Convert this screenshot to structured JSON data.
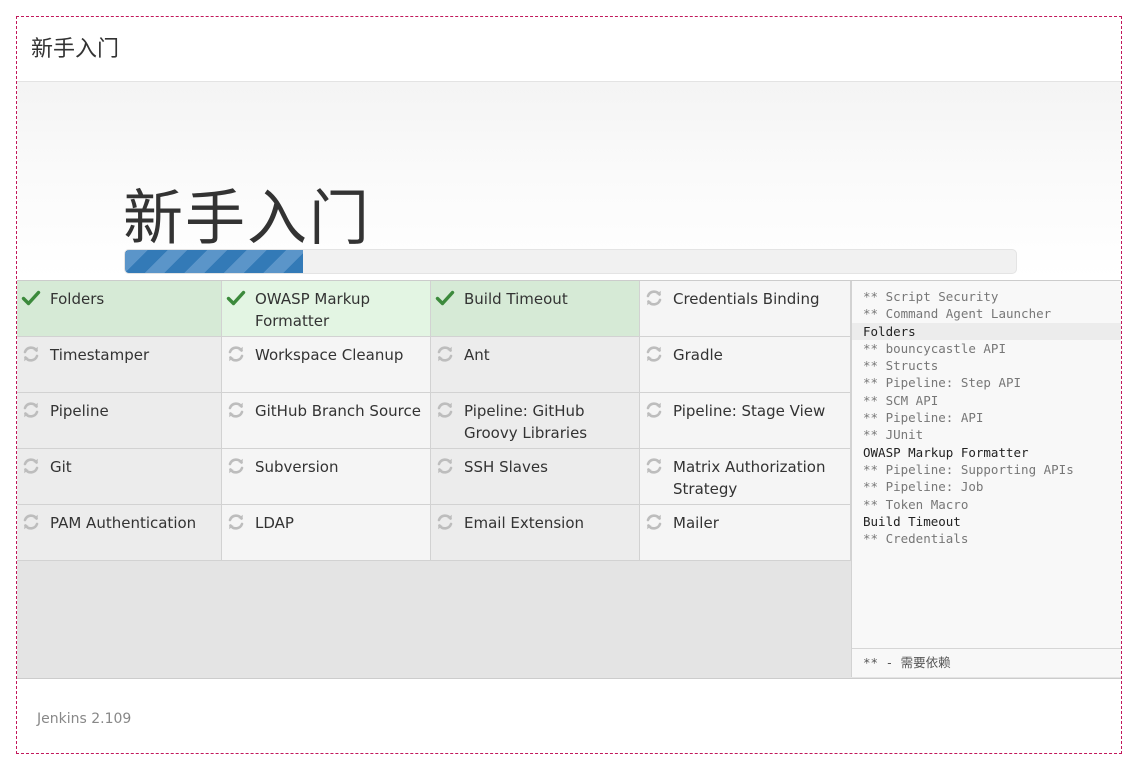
{
  "header": {
    "title": "新手入门"
  },
  "hero": {
    "title": "新手入门",
    "progress": 0.2
  },
  "colors": {
    "done_icon": "#3c8a3c",
    "pending_icon": "#bdbdbd",
    "progress": "#337ab7",
    "frame_border": "#c2185b"
  },
  "plugins": [
    {
      "label": "Folders",
      "status": "done"
    },
    {
      "label": "OWASP Markup Formatter",
      "status": "done"
    },
    {
      "label": "Build Timeout",
      "status": "done"
    },
    {
      "label": "Credentials Binding",
      "status": "pending"
    },
    {
      "label": "Timestamper",
      "status": "pending"
    },
    {
      "label": "Workspace Cleanup",
      "status": "pending"
    },
    {
      "label": "Ant",
      "status": "pending"
    },
    {
      "label": "Gradle",
      "status": "pending"
    },
    {
      "label": "Pipeline",
      "status": "pending"
    },
    {
      "label": "GitHub Branch Source",
      "status": "pending"
    },
    {
      "label": "Pipeline: GitHub Groovy Libraries",
      "status": "pending"
    },
    {
      "label": "Pipeline: Stage View",
      "status": "pending"
    },
    {
      "label": "Git",
      "status": "pending"
    },
    {
      "label": "Subversion",
      "status": "pending"
    },
    {
      "label": "SSH Slaves",
      "status": "pending"
    },
    {
      "label": "Matrix Authorization Strategy",
      "status": "pending"
    },
    {
      "label": "PAM Authentication",
      "status": "pending"
    },
    {
      "label": "LDAP",
      "status": "pending"
    },
    {
      "label": "Email Extension",
      "status": "pending"
    },
    {
      "label": "Mailer",
      "status": "pending"
    }
  ],
  "install_log": {
    "lines": [
      {
        "text": "** Script Security",
        "dep": true
      },
      {
        "text": "** Command Agent Launcher",
        "dep": true
      },
      {
        "text": "Folders",
        "dep": false
      },
      {
        "text": "** bouncycastle API",
        "dep": true
      },
      {
        "text": "** Structs",
        "dep": true
      },
      {
        "text": "** Pipeline: Step API",
        "dep": true
      },
      {
        "text": "** SCM API",
        "dep": true
      },
      {
        "text": "** Pipeline: API",
        "dep": true
      },
      {
        "text": "** JUnit",
        "dep": true
      },
      {
        "text": "OWASP Markup Formatter",
        "dep": false
      },
      {
        "text": "** Pipeline: Supporting APIs",
        "dep": true
      },
      {
        "text": "** Pipeline: Job",
        "dep": true
      },
      {
        "text": "** Token Macro",
        "dep": true
      },
      {
        "text": "Build Timeout",
        "dep": false
      },
      {
        "text": "** Credentials",
        "dep": true
      }
    ],
    "legend": "** - 需要依赖"
  },
  "footer": {
    "version": "Jenkins 2.109"
  }
}
